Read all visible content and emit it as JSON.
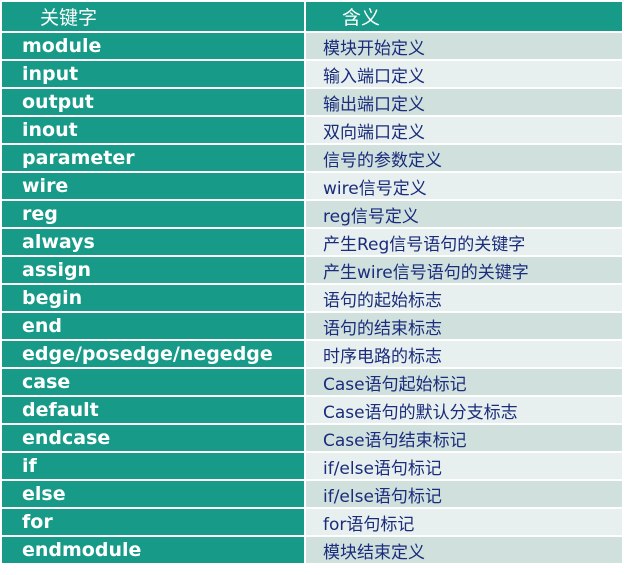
{
  "header": {
    "col_keyword": "关键字",
    "col_meaning": "含义"
  },
  "colors": {
    "header_bg": "#179a87",
    "keyword_cell_bg": "#179a87",
    "desc_odd_bg": "#cfe0dd",
    "desc_even_bg": "#e7f0ee",
    "desc_text": "#1a2c7b"
  },
  "rows": [
    {
      "keyword": "module",
      "meaning": "模块开始定义"
    },
    {
      "keyword": "input",
      "meaning": "输入端口定义"
    },
    {
      "keyword": "output",
      "meaning": "输出端口定义"
    },
    {
      "keyword": "inout",
      "meaning": "双向端口定义"
    },
    {
      "keyword": "parameter",
      "meaning": "信号的参数定义"
    },
    {
      "keyword": "wire",
      "meaning": "wire信号定义"
    },
    {
      "keyword": "reg",
      "meaning": "reg信号定义"
    },
    {
      "keyword": "always",
      "meaning": "产生Reg信号语句的关键字"
    },
    {
      "keyword": "assign",
      "meaning": "产生wire信号语句的关键字"
    },
    {
      "keyword": "begin",
      "meaning": "语句的起始标志"
    },
    {
      "keyword": "end",
      "meaning": "语句的结束标志"
    },
    {
      "keyword": "edge/posedge/negedge",
      "meaning": "时序电路的标志"
    },
    {
      "keyword": "case",
      "meaning": "Case语句起始标记"
    },
    {
      "keyword": "default",
      "meaning": "Case语句的默认分支标志"
    },
    {
      "keyword": "endcase",
      "meaning": "Case语句结束标记"
    },
    {
      "keyword": "if",
      "meaning": "if/else语句标记"
    },
    {
      "keyword": "else",
      "meaning": "if/else语句标记"
    },
    {
      "keyword": "for",
      "meaning": "for语句标记"
    },
    {
      "keyword": "endmodule",
      "meaning": "模块结束定义"
    }
  ]
}
